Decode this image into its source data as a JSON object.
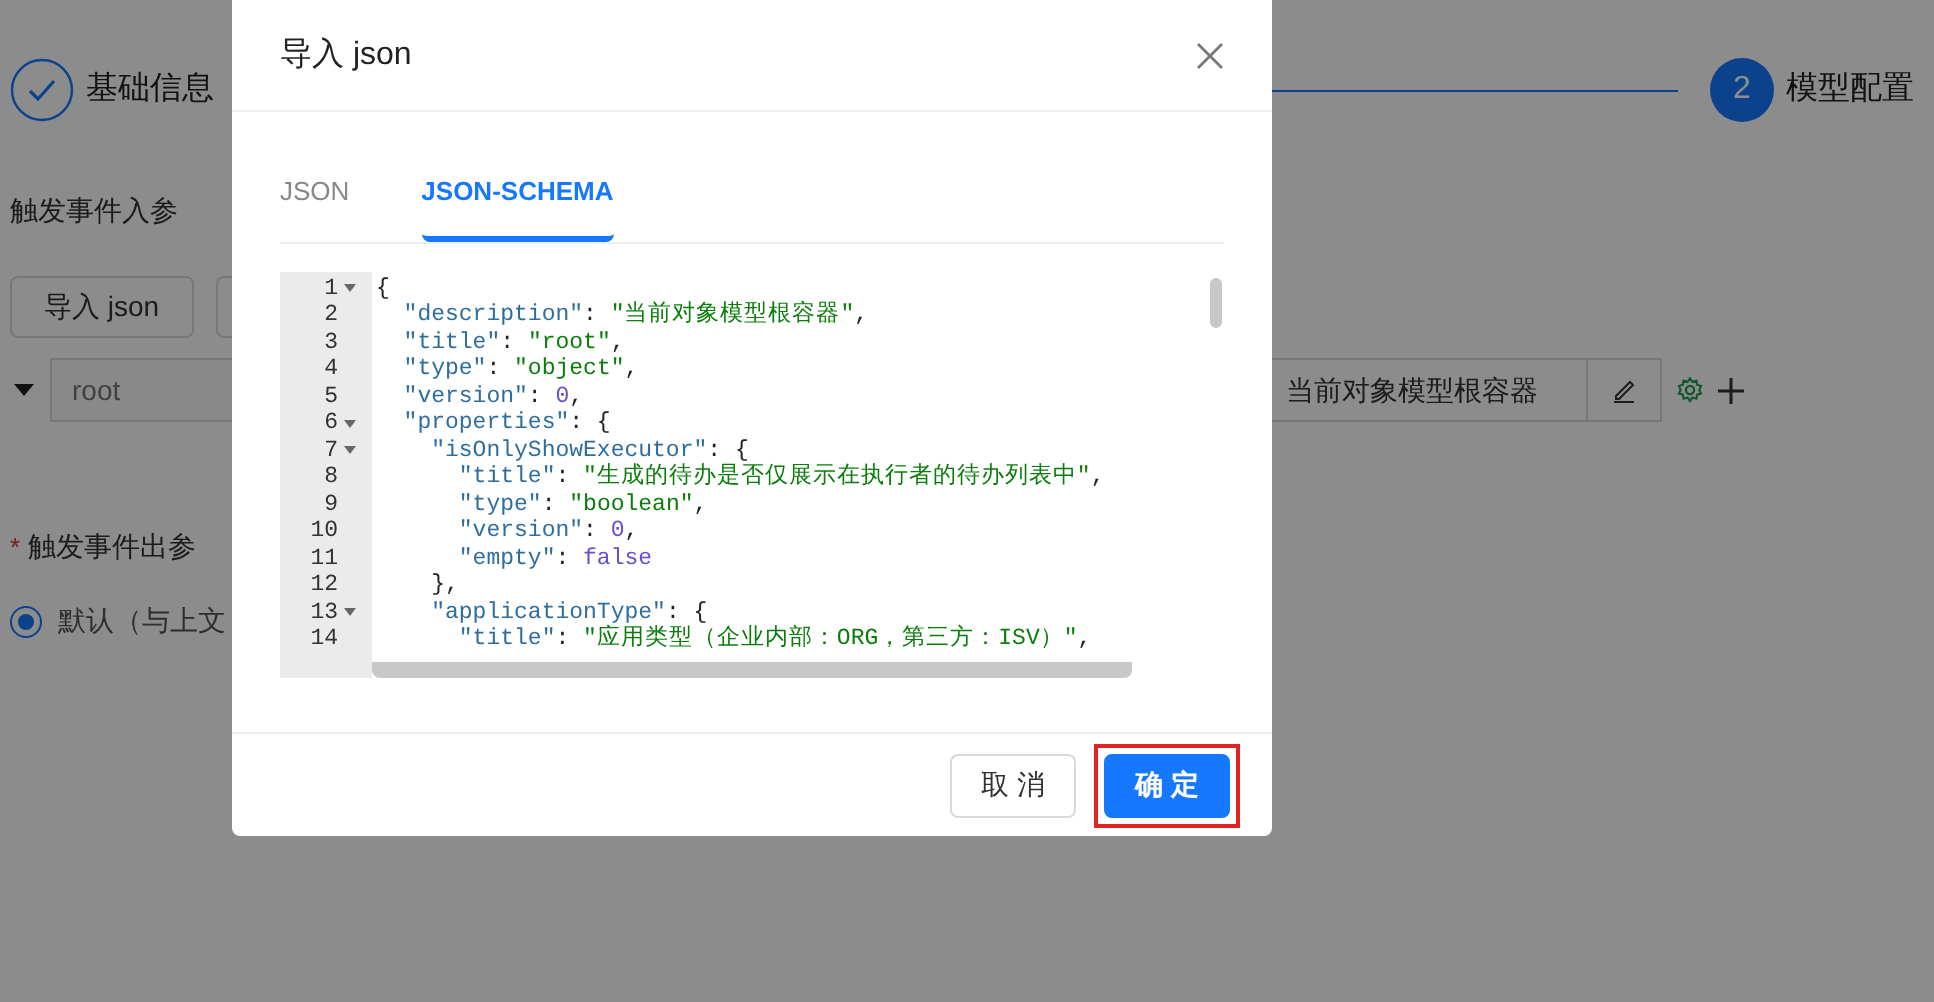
{
  "page": {
    "steps": [
      {
        "label": "基础信息",
        "done": true
      },
      {
        "number": "2",
        "label": "模型配置",
        "done": false
      }
    ],
    "input_section": {
      "title": "触发事件入参",
      "import_button": "导入 json",
      "root_row": {
        "expanded": true,
        "name_placeholder": "root",
        "description": "当前对象模型根容器"
      }
    },
    "output_section": {
      "required_mark": "*",
      "title": "触发事件出参",
      "options": [
        {
          "label": "默认（与上文",
          "selected": true
        }
      ]
    }
  },
  "modal": {
    "title": "导入 json",
    "tabs": [
      {
        "label": "JSON",
        "selected": false
      },
      {
        "label": "JSON-SCHEMA",
        "selected": true
      }
    ],
    "editor": {
      "lines": [
        {
          "no": "1",
          "fold": true,
          "tokens": [
            {
              "kind": "punct",
              "text": "{"
            }
          ]
        },
        {
          "no": "2",
          "fold": false,
          "tokens": [
            {
              "kind": "key",
              "text": "  \"description\""
            },
            {
              "kind": "punct",
              "text": ": "
            },
            {
              "kind": "string",
              "text": "\"当前对象模型根容器\""
            },
            {
              "kind": "punct",
              "text": ","
            }
          ]
        },
        {
          "no": "3",
          "fold": false,
          "tokens": [
            {
              "kind": "key",
              "text": "  \"title\""
            },
            {
              "kind": "punct",
              "text": ": "
            },
            {
              "kind": "string",
              "text": "\"root\""
            },
            {
              "kind": "punct",
              "text": ","
            }
          ]
        },
        {
          "no": "4",
          "fold": false,
          "tokens": [
            {
              "kind": "key",
              "text": "  \"type\""
            },
            {
              "kind": "punct",
              "text": ": "
            },
            {
              "kind": "string",
              "text": "\"object\""
            },
            {
              "kind": "punct",
              "text": ","
            }
          ]
        },
        {
          "no": "5",
          "fold": false,
          "tokens": [
            {
              "kind": "key",
              "text": "  \"version\""
            },
            {
              "kind": "punct",
              "text": ": "
            },
            {
              "kind": "literal",
              "text": "0"
            },
            {
              "kind": "punct",
              "text": ","
            }
          ]
        },
        {
          "no": "6",
          "fold": true,
          "tokens": [
            {
              "kind": "key",
              "text": "  \"properties\""
            },
            {
              "kind": "punct",
              "text": ": {"
            }
          ]
        },
        {
          "no": "7",
          "fold": true,
          "tokens": [
            {
              "kind": "key",
              "text": "    \"isOnlyShowExecutor\""
            },
            {
              "kind": "punct",
              "text": ": {"
            }
          ]
        },
        {
          "no": "8",
          "fold": false,
          "tokens": [
            {
              "kind": "key",
              "text": "      \"title\""
            },
            {
              "kind": "punct",
              "text": ": "
            },
            {
              "kind": "string",
              "text": "\"生成的待办是否仅展示在执行者的待办列表中\""
            },
            {
              "kind": "punct",
              "text": ","
            }
          ]
        },
        {
          "no": "9",
          "fold": false,
          "tokens": [
            {
              "kind": "key",
              "text": "      \"type\""
            },
            {
              "kind": "punct",
              "text": ": "
            },
            {
              "kind": "string",
              "text": "\"boolean\""
            },
            {
              "kind": "punct",
              "text": ","
            }
          ]
        },
        {
          "no": "10",
          "fold": false,
          "tokens": [
            {
              "kind": "key",
              "text": "      \"version\""
            },
            {
              "kind": "punct",
              "text": ": "
            },
            {
              "kind": "literal",
              "text": "0"
            },
            {
              "kind": "punct",
              "text": ","
            }
          ]
        },
        {
          "no": "11",
          "fold": false,
          "tokens": [
            {
              "kind": "key",
              "text": "      \"empty\""
            },
            {
              "kind": "punct",
              "text": ": "
            },
            {
              "kind": "literal",
              "text": "false"
            }
          ]
        },
        {
          "no": "12",
          "fold": false,
          "tokens": [
            {
              "kind": "punct",
              "text": "    },"
            }
          ]
        },
        {
          "no": "13",
          "fold": true,
          "tokens": [
            {
              "kind": "key",
              "text": "    \"applicationType\""
            },
            {
              "kind": "punct",
              "text": ": {"
            }
          ]
        },
        {
          "no": "14",
          "fold": false,
          "tokens": [
            {
              "kind": "key",
              "text": "      \"title\""
            },
            {
              "kind": "punct",
              "text": ": "
            },
            {
              "kind": "string",
              "text": "\"应用类型（企业内部：ORG，第三方：ISV）\""
            },
            {
              "kind": "punct",
              "text": ","
            }
          ]
        }
      ]
    },
    "buttons": [
      {
        "label": "取消",
        "kind": "default"
      },
      {
        "label": "确定",
        "kind": "primary",
        "highlighted": true
      }
    ]
  }
}
